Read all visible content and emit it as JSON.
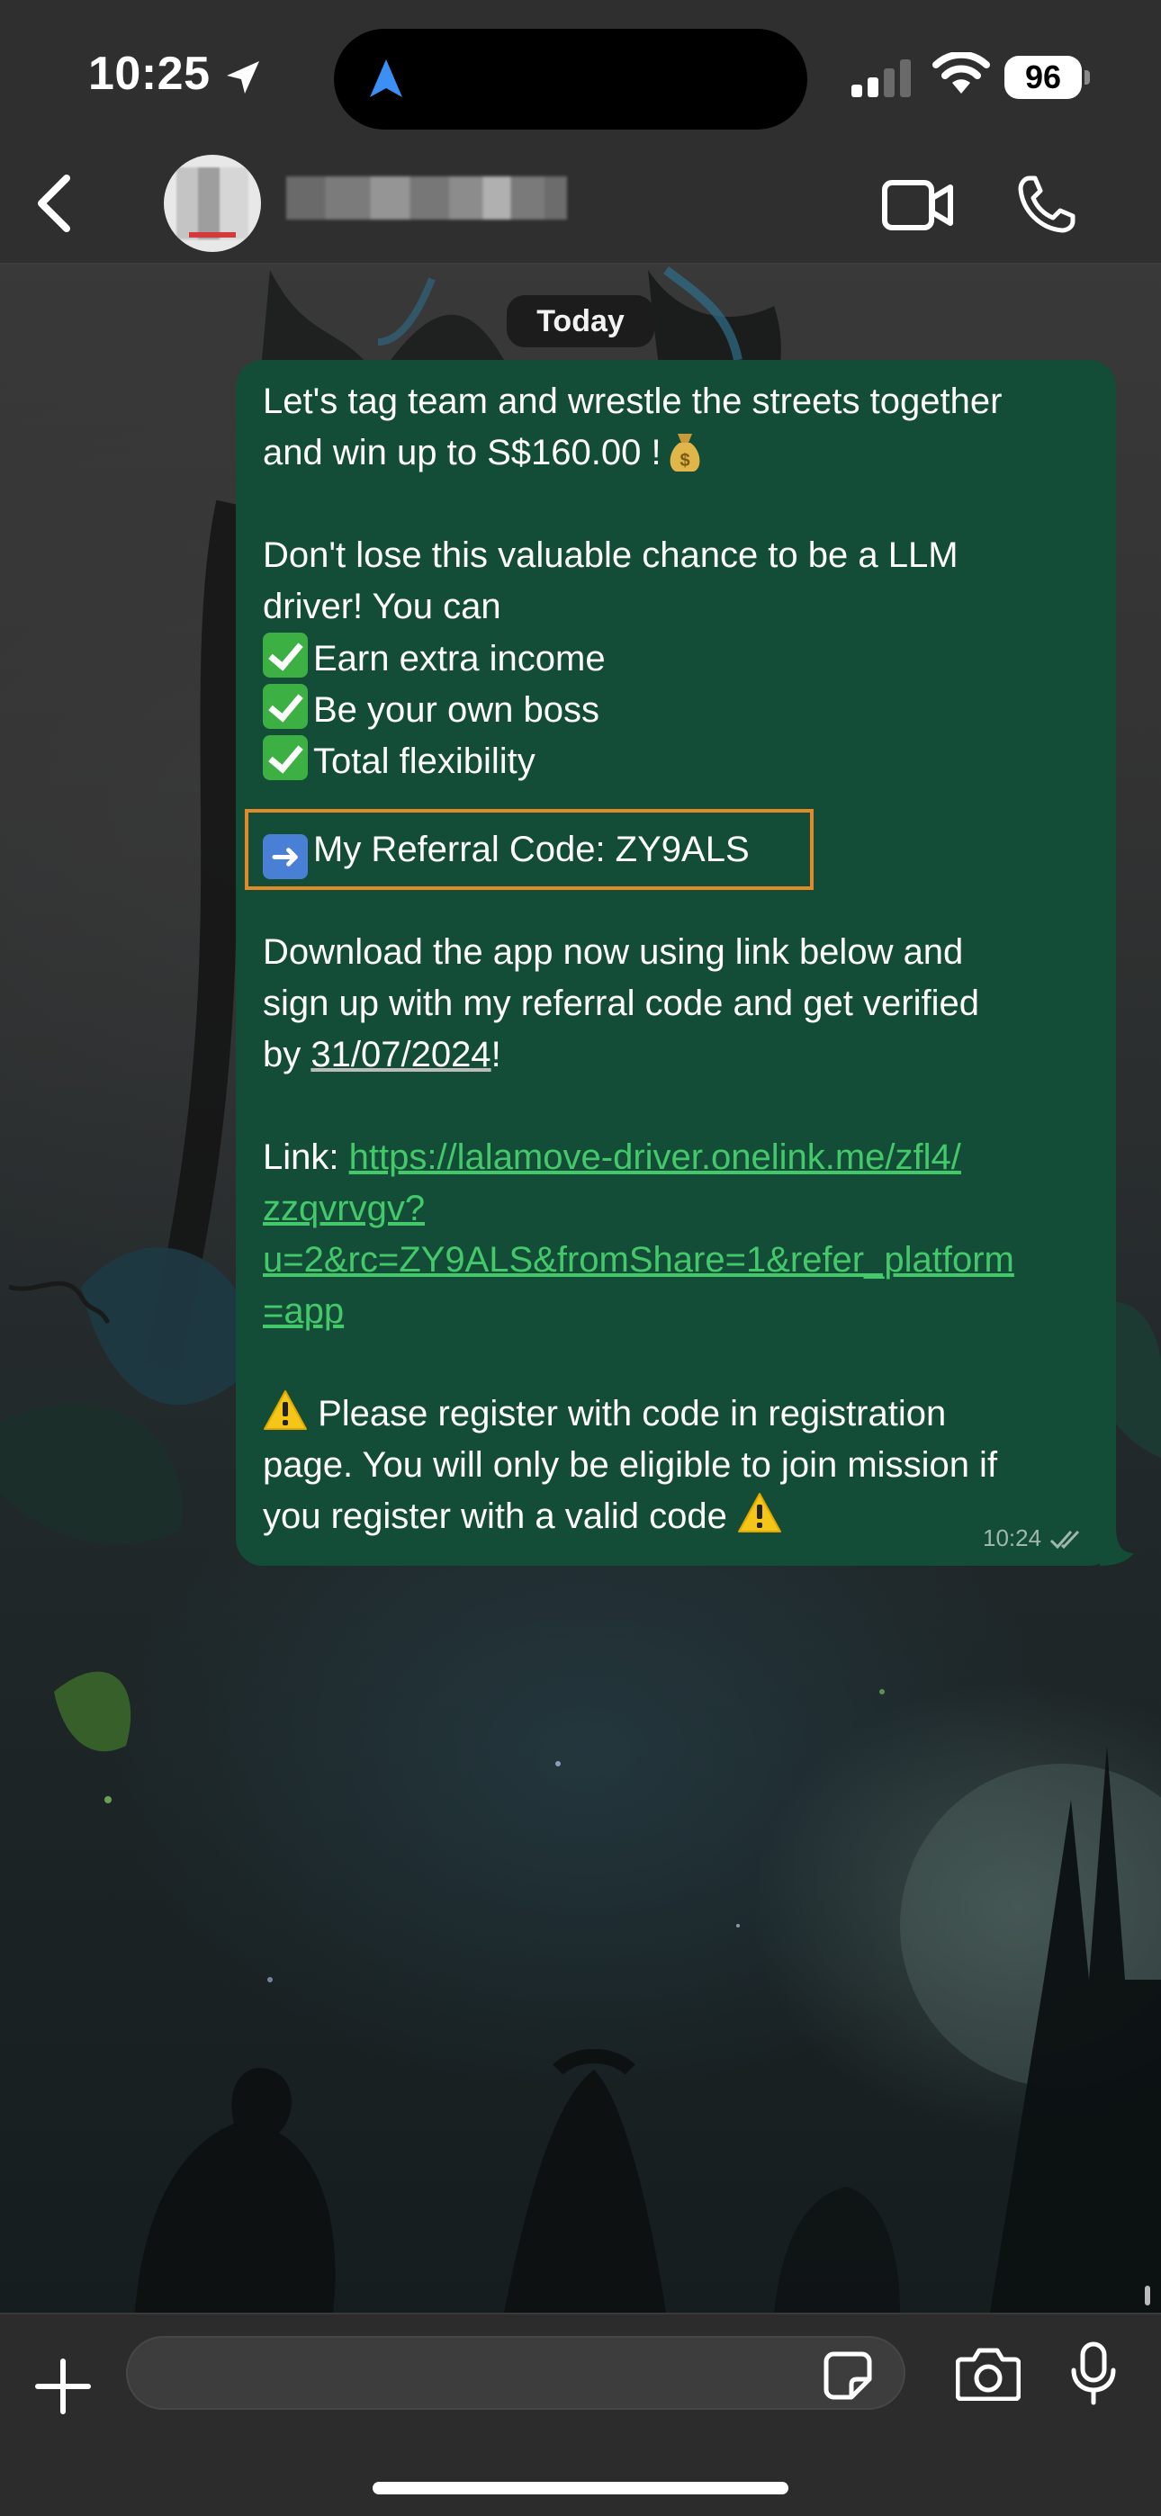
{
  "status_bar": {
    "time": "10:25",
    "battery": "96"
  },
  "chat": {
    "date_separator": "Today"
  },
  "message": {
    "lines": [
      "Let's tag team and wrestle the streets together",
      "and win up to S$160.00 !",
      "Don't lose this valuable chance to be a LLM",
      "driver! You can",
      "Earn extra income",
      "Be your own boss",
      "Total flexibility",
      "My Referral Code: ZY9ALS",
      "Download the app now using link below and",
      "sign up with my referral code and get verified",
      "by ",
      "31/07/2024",
      "!",
      "Link: ",
      "https://lalamove-driver.onelink.me/zfl4/",
      "zzqvrvgv?",
      "u=2&rc=ZY9ALS&fromShare=1&refer_platform",
      "=app",
      " Please register with code in registration",
      "page. You will only be eligible to join mission if",
      "you register with a valid code "
    ],
    "time": "10:24"
  },
  "composer": {
    "placeholder": ""
  },
  "colors": {
    "bubble": "#134d37",
    "link": "#44c96a",
    "highlight_border": "#e08a2a",
    "header_bg": "#2f2f2f"
  },
  "icons": {
    "back": "chevron-left-icon",
    "video": "video-camera-icon",
    "call": "phone-icon",
    "add": "plus-icon",
    "sticker": "sticker-icon",
    "camera": "camera-icon",
    "mic": "microphone-icon"
  }
}
